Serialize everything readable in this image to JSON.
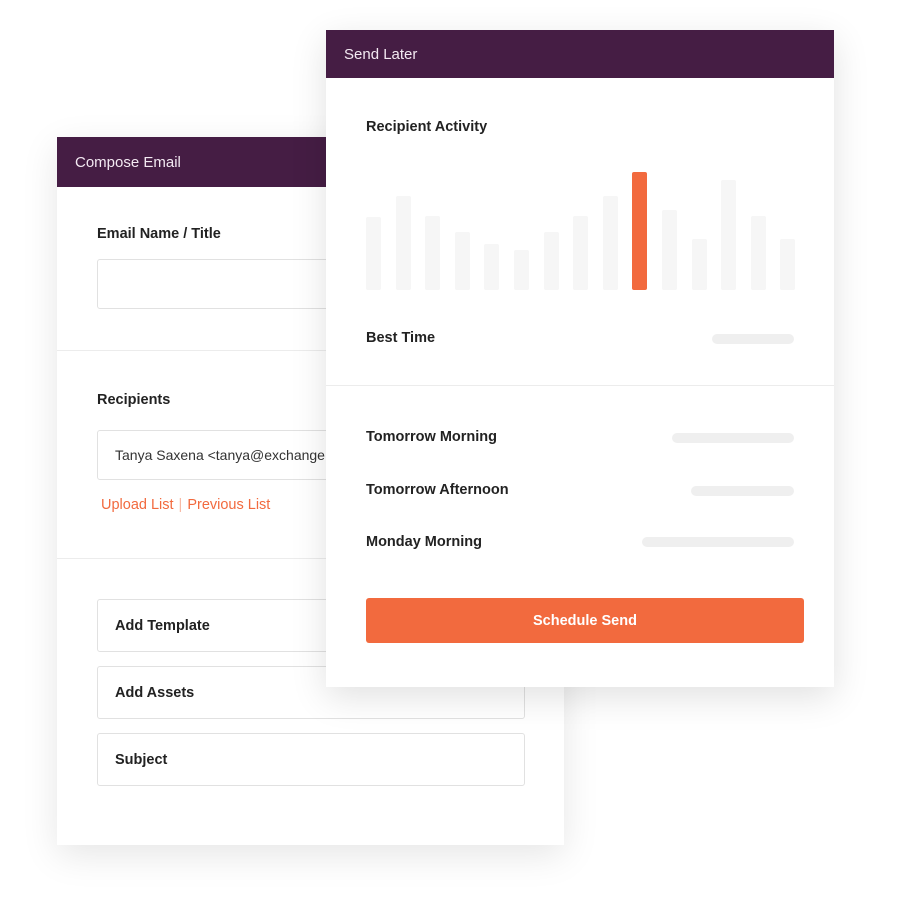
{
  "compose": {
    "header_title": "Compose Email",
    "email_name_label": "Email Name / Title",
    "email_name_value": "",
    "recipients_label": "Recipients",
    "recipients_value": "Tanya Saxena <tanya@exchange",
    "upload_list_link": "Upload List",
    "link_separator": "|",
    "previous_list_link": "Previous List",
    "options": [
      {
        "label": "Add Template"
      },
      {
        "label": "Add Assets"
      },
      {
        "label": "Subject"
      }
    ]
  },
  "send_later": {
    "header_title": "Send Later",
    "activity_label": "Recipient Activity",
    "activity_levels": [
      0.62,
      0.8,
      0.63,
      0.49,
      0.39,
      0.34,
      0.49,
      0.63,
      0.8,
      1.0,
      0.68,
      0.43,
      0.93,
      0.63,
      0.43
    ],
    "active_index": 9,
    "best_time_label": "Best Time",
    "slots": [
      {
        "label": "Tomorrow Morning"
      },
      {
        "label": "Tomorrow Afternoon"
      },
      {
        "label": "Monday Morning"
      }
    ],
    "schedule_button": "Schedule Send"
  },
  "colors": {
    "header_bg": "#451d44",
    "accent": "#f26a3e",
    "bar_inactive": "#f6f6f6",
    "placeholder": "#efefef"
  }
}
